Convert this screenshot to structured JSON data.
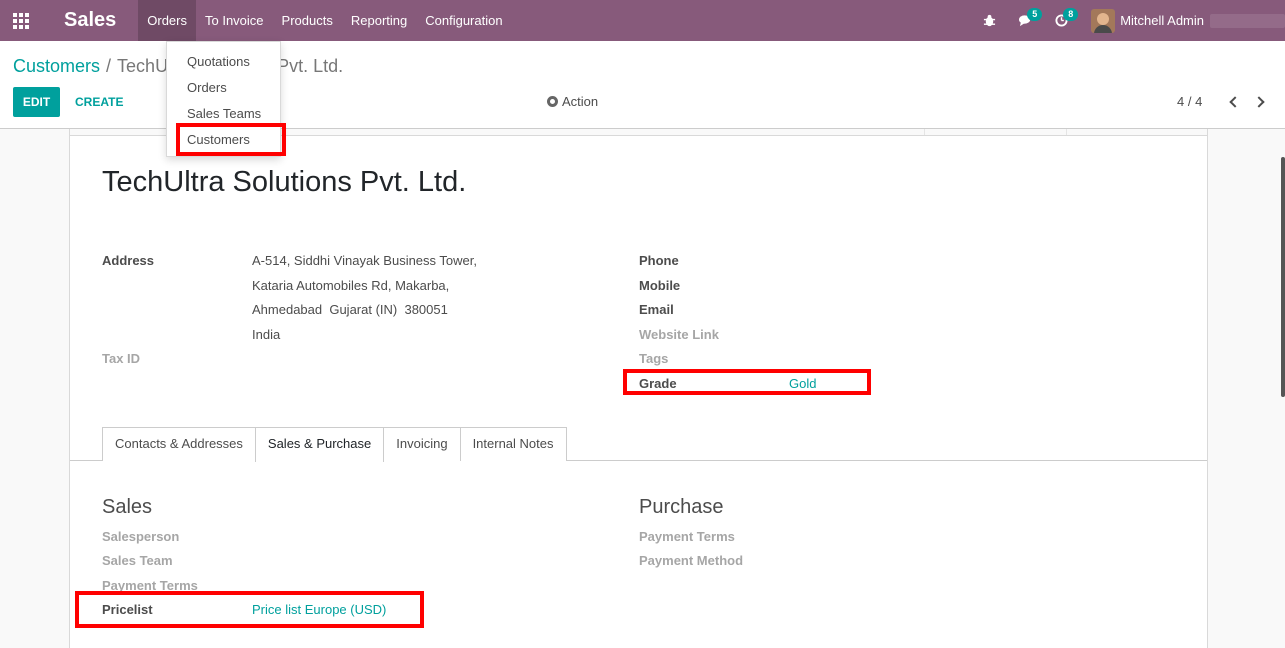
{
  "navbar": {
    "app_name": "Sales",
    "menu": [
      "Orders",
      "To Invoice",
      "Products",
      "Reporting",
      "Configuration"
    ],
    "messages_count": "5",
    "activities_count": "8",
    "user_name": "Mitchell Admin",
    "brand_color": "#875a7b"
  },
  "orders_dropdown": {
    "items": [
      "Quotations",
      "Orders",
      "Sales Teams",
      "Customers"
    ]
  },
  "breadcrumb": {
    "parent": "Customers",
    "current": "TechUltra Solutions Pvt. Ltd.",
    "current_visible": "TechU",
    "current_tail": "Pvt. Ltd."
  },
  "toolbar": {
    "edit": "EDIT",
    "create": "CREATE",
    "action": "Action",
    "pager": "4 / 4"
  },
  "record": {
    "name": "TechUltra Solutions Pvt. Ltd.",
    "address_label": "Address",
    "address_lines": [
      "A-514, Siddhi Vinayak Business Tower,",
      "Kataria Automobiles Rd, Makarba,",
      "Ahmedabad  Gujarat (IN)  380051",
      "India"
    ],
    "tax_id_label": "Tax ID",
    "phone_label": "Phone",
    "mobile_label": "Mobile",
    "email_label": "Email",
    "website_label": "Website Link",
    "tags_label": "Tags",
    "grade_label": "Grade",
    "grade_value": "Gold"
  },
  "tabs": [
    "Contacts & Addresses",
    "Sales & Purchase",
    "Invoicing",
    "Internal Notes"
  ],
  "active_tab": "Sales & Purchase",
  "sales_section": {
    "title": "Sales",
    "salesperson": "Salesperson",
    "sales_team": "Sales Team",
    "payment_terms": "Payment Terms",
    "pricelist_label": "Pricelist",
    "pricelist_value": "Price list Europe (USD)"
  },
  "purchase_section": {
    "title": "Purchase",
    "payment_terms": "Payment Terms",
    "payment_method": "Payment Method"
  },
  "accent_color": "#00a09d",
  "highlight_color": "#ff0000"
}
